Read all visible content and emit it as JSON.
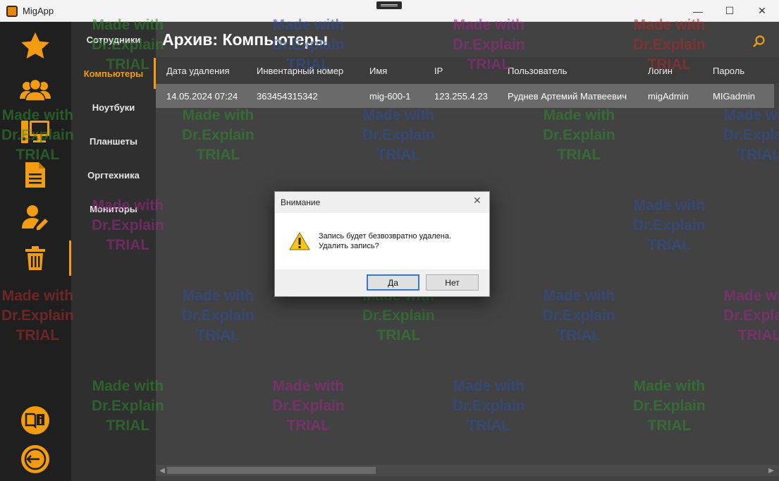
{
  "window": {
    "title": "MigApp",
    "min": "—",
    "max": "☐",
    "close": "✕"
  },
  "rail": {
    "items": [
      "star-icon",
      "users-icon",
      "computer-icon",
      "document-icon",
      "user-edit-icon",
      "trash-icon"
    ],
    "bottom": [
      "book-info-icon",
      "logout-icon"
    ],
    "accent": "#f39c12"
  },
  "subnav": {
    "items": [
      {
        "label": "Сотрудники"
      },
      {
        "label": "Компьютеры"
      },
      {
        "label": "Ноутбуки"
      },
      {
        "label": "Планшеты"
      },
      {
        "label": "Оргтехника"
      },
      {
        "label": "Мониторы"
      }
    ],
    "active_index": 1
  },
  "main": {
    "title": "Архив: Компьютеры",
    "columns": [
      "Дата удаления",
      "Инвентарный номер",
      "Имя",
      "IP",
      "Пользователь",
      "Логин",
      "Пароль"
    ],
    "rows": [
      [
        "14.05.2024 07:24",
        "363454315342",
        "mig-600-1",
        "123.255.4.23",
        "Руднев Артемий Матвеевич",
        "migAdmin",
        "MIGadmin"
      ]
    ]
  },
  "dialog": {
    "title": "Внимание",
    "close": "✕",
    "message_line1": "Запись будет безвозвратно удалена.",
    "message_line2": "Удалить запись?",
    "yes_label": "Да",
    "no_label": "Нет"
  },
  "watermark": {
    "line1": "Made with",
    "line2": "Dr.Explain",
    "line3": "TRIAL"
  }
}
